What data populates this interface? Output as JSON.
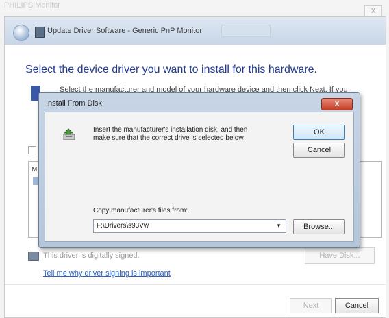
{
  "top_strip": {
    "text": "PHILIPS Monitor",
    "close_glyph": "X"
  },
  "wizard": {
    "title": "Update Driver Software - Generic PnP Monitor",
    "heading": "Select the device driver you want to install for this hardware.",
    "instruction": "Select the manufacturer and model of your hardware device and then click Next. If you",
    "list_partial": "M",
    "unsigned_text": "This driver is digitally signed.",
    "have_disk": "Have Disk...",
    "signing_link": "Tell me why driver signing is important",
    "next": "Next",
    "cancel": "Cancel"
  },
  "dialog": {
    "title": "Install From Disk",
    "close_glyph": "X",
    "message": "Insert the manufacturer's installation disk, and then make sure that the correct drive is selected below.",
    "ok": "OK",
    "cancel": "Cancel",
    "copy_label": "Copy manufacturer's files from:",
    "path_value": "F:\\Drivers\\s93Vw",
    "browse": "Browse..."
  },
  "icons": [
    "back-icon",
    "device-icon",
    "disk-drive-icon",
    "shield-icon",
    "dropdown-arrow-icon",
    "close-icon"
  ]
}
